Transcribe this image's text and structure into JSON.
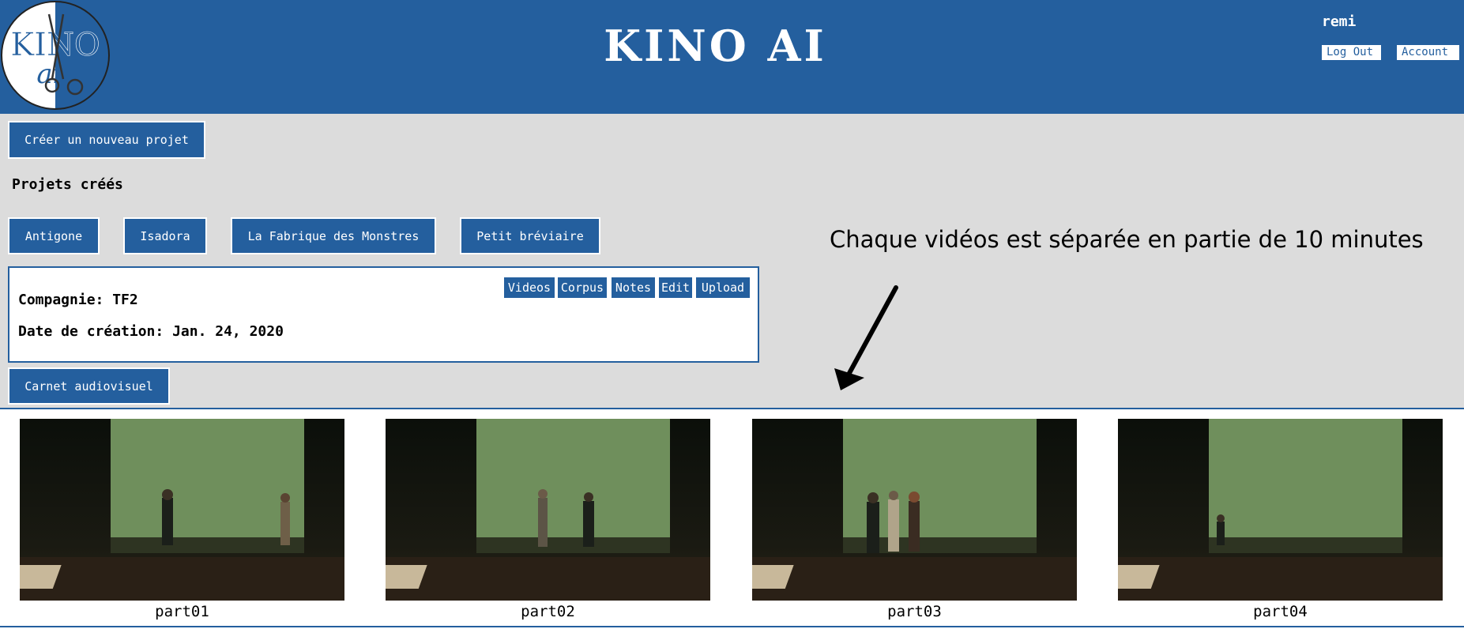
{
  "header": {
    "logo_text": "KINO",
    "logo_sub": "ai",
    "title": "KINO AI",
    "username": "remi",
    "logout_label": "Log Out",
    "account_label": "Account"
  },
  "main": {
    "new_project_label": "Créer un nouveau projet",
    "projects_title": "Projets créés",
    "projects": [
      {
        "label": "Antigone"
      },
      {
        "label": "Isadora"
      },
      {
        "label": "La Fabrique des Monstres"
      },
      {
        "label": "Petit bréviaire"
      }
    ],
    "info": {
      "company": "Compagnie: TF2",
      "created": "Date de création: Jan. 24, 2020",
      "buttons": [
        "Videos",
        "Corpus",
        "Notes",
        "Edit",
        "Upload"
      ]
    },
    "carnet_label": "Carnet audiovisuel"
  },
  "annotation": {
    "text": "Chaque vidéos est séparée en partie de 10 minutes"
  },
  "videos": [
    {
      "label": "part01"
    },
    {
      "label": "part02"
    },
    {
      "label": "part03"
    },
    {
      "label": "part04"
    }
  ],
  "colors": {
    "brand": "#245f9e",
    "background": "#dcdcdc",
    "white": "#ffffff"
  },
  "icons": {
    "logo": "kino-ai-scissors-logo",
    "annotation": "arrow-down-left-icon"
  }
}
